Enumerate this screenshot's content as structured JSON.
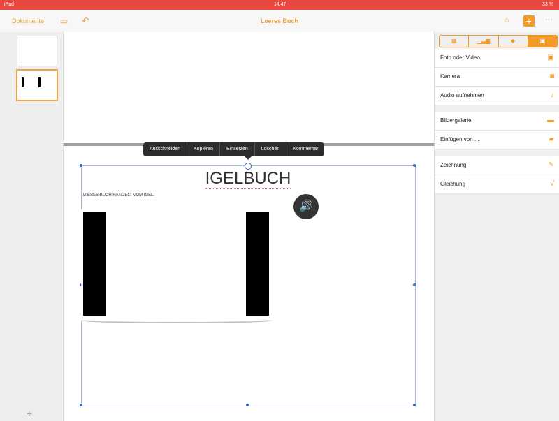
{
  "status": {
    "left": "iPad",
    "time": "14:47",
    "battery": "33 %"
  },
  "toolbar": {
    "back_label": "Dokumente",
    "title": "Leeres Buch",
    "more_label": "···"
  },
  "context_menu": [
    "Ausschneiden",
    "Kopieren",
    "Einsetzen",
    "Löschen",
    "Kommentar"
  ],
  "page": {
    "heading": "IGELBUCH",
    "subtext": "DIESES BUCH HANDELT VOM IGEL!"
  },
  "sidebar": {
    "add_label": "+"
  },
  "insert_panel": {
    "tabs": [
      "table-icon",
      "chart-icon",
      "shape-icon",
      "media-icon"
    ],
    "groups": [
      [
        {
          "label": "Foto oder Video",
          "icon": "photo-icon"
        },
        {
          "label": "Kamera",
          "icon": "camera-icon"
        },
        {
          "label": "Audio aufnehmen",
          "icon": "microphone-icon"
        }
      ],
      [
        {
          "label": "Bildergalerie",
          "icon": "gallery-icon"
        },
        {
          "label": "Einfügen von ...",
          "icon": "folder-icon"
        }
      ],
      [
        {
          "label": "Zeichnung",
          "icon": "drawing-icon"
        },
        {
          "label": "Gleichung",
          "icon": "equation-icon"
        }
      ]
    ]
  }
}
